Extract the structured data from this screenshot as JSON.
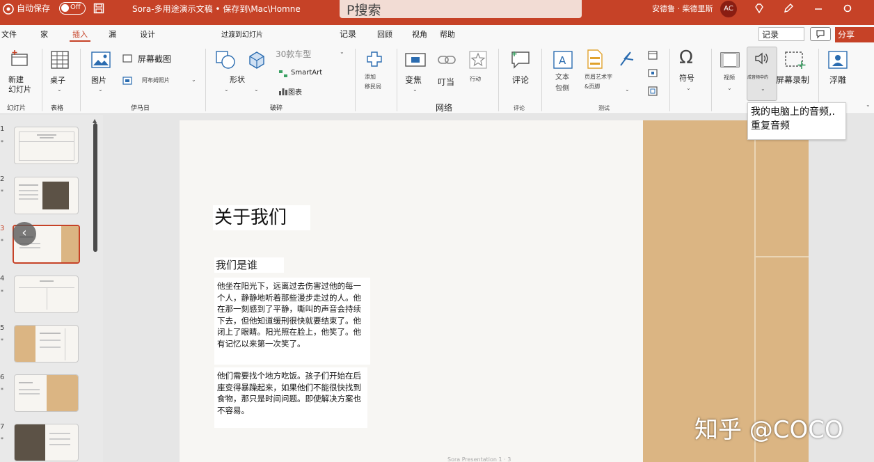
{
  "titlebar": {
    "autosave_label": "自动保存",
    "autosave_state": "Off",
    "doc_title": "Sora-多用途演示文稿 • 保存到\\Mac\\Homne",
    "search_placeholder": "P搜索",
    "user_name": "安德鲁 · 柴德里斯",
    "avatar_initials": "AC"
  },
  "menu": {
    "items": [
      "文件",
      "家",
      "插入",
      "漏",
      "设计",
      "过渡到幻灯片",
      "记录",
      "回顾",
      "视角",
      "帮助"
    ],
    "active": "插入",
    "record_input": "记录",
    "share_label": "分享"
  },
  "ribbon": {
    "new_slide": "新建\n幻灯片",
    "group_slides": "幻灯片",
    "table": "桌子",
    "group_table": "表格",
    "picture": "图片",
    "screenshot": "屏幕截图",
    "photo_album": "阿布姆照片",
    "group_images": "伊马日",
    "model_3d": "30款车型",
    "shapes": "形状",
    "smartart": "SmartArt",
    "chart": "图表",
    "group_illustrations": "破碎",
    "addins": "添加\n移民局",
    "zoom": "变焦",
    "link": "叮当",
    "action": "行动",
    "group_links": "网络",
    "comment": "评论",
    "group_comments": "评论",
    "textbox": "文本\n包侧",
    "header_footer": "页眉艺术字\n&页脚",
    "group_text": "测试",
    "symbol": "符号",
    "video": "视频",
    "audio": "成音频中的",
    "screen_recording": "屏幕录制",
    "cameo": "浮雕"
  },
  "tooltip": {
    "text": "我的电脑上的音频,.重复音频"
  },
  "thumbnails": {
    "numbers": [
      "1",
      "2",
      "3",
      "4",
      "5",
      "6",
      "7"
    ],
    "active_index": 3,
    "star": "*"
  },
  "slide": {
    "title": "关于我们",
    "subtitle": "我们是谁",
    "para1": "他坐在阳光下，远离过去伤害过他的每一个人，静静地听着那些漫步走过的人。他在那一刻感到了平静，嘶叫的声音会持续下去，但他知道缓刑很快就要结束了。他闭上了眼睛。阳光照在脸上，他笑了。他有记忆以来第一次笑了。",
    "para2": "他们需要找个地方吃饭。孩子们开始在后座变得暴躁起来，如果他们不能很快找到食物，那只是时间问题。即使解决方案也不容易。",
    "footer": "Sora Presentation 1 · 3"
  },
  "watermark": "知乎 @COCO",
  "colors": {
    "accent": "#c64227",
    "slide_tan": "#dbb583",
    "thumb_dark": "#5c5246"
  }
}
